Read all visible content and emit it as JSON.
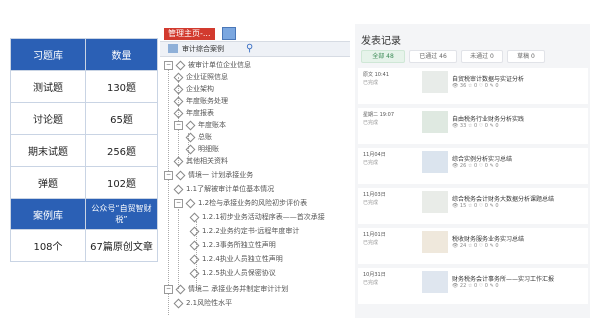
{
  "lib_table": {
    "header": [
      "习题库",
      "数量"
    ],
    "rows": [
      [
        "测试题",
        "130题"
      ],
      [
        "讨论题",
        "65题"
      ],
      [
        "期末试题",
        "256题"
      ],
      [
        "弹题",
        "102题"
      ]
    ],
    "header2": [
      "案例库",
      "公众号“自贸智财税”"
    ],
    "row2": [
      "108个",
      "67篇原创文章"
    ]
  },
  "tree": {
    "title": "管理主页-...",
    "toolbar_label": "审计综合案例",
    "nodes": [
      "被审计单位企业信息",
      "企业证照信息",
      "企业架构",
      "年度账务处理",
      "年度报表",
      "年度账本",
      "总账",
      "明细账",
      "其他相关资料",
      "情境一 计划承接业务",
      "1.1了解被审计单位基本情况",
      "1.2检与承接业务的风险初步评价表",
      "1.2.1初步业务活动程序表——首次承接",
      "1.2.2业务约定书-远程年度审计",
      "1.2.3事务所独立性声明",
      "1.2.4执业人员独立性声明",
      "1.2.5执业人员保密协议",
      "情境二 承接业务并制定审计计划",
      "2.1风险性水平"
    ]
  },
  "feed": {
    "title": "发表记录",
    "tabs": [
      "全部 48",
      "已通过 46",
      "未通过 0",
      "草稿 0"
    ],
    "posts": [
      {
        "meta": "原文 10:41",
        "meta2": "已完成",
        "title": "自贸税审计数据与实证分析",
        "stats": "👁 36   ☆ 0   ♡ 0   ✎ 0"
      },
      {
        "meta": "星期二 19:07",
        "meta2": "已完成",
        "title": "自由税务行业财务分析实践",
        "stats": "👁 33   ☆ 0   ♡ 0   ✎ 0"
      },
      {
        "meta": "11月04日",
        "meta2": "已完成",
        "title": "综合实例分析实习总结",
        "stats": "👁 26   ☆ 0   ♡ 0   ✎ 0"
      },
      {
        "meta": "11月03日",
        "meta2": "已完成",
        "title": "综合税务会计财务大数据分析课题总结",
        "stats": "👁 15   ☆ 0   ♡ 0   ✎ 0"
      },
      {
        "meta": "11月01日",
        "meta2": "已完成",
        "title": "税收财务服务业务实习总结",
        "stats": "👁 24   ☆ 0   ♡ 0   ✎ 0"
      },
      {
        "meta": "10月31日",
        "meta2": "已完成",
        "title": "财务税务会计事务所——实习工作汇报",
        "stats": "👁 22   ☆ 0   ♡ 0   ✎ 0"
      }
    ]
  },
  "colors": {
    "table_header": "#2b60b5",
    "title_red": "#d23a2e",
    "feed_bg": "#f4f5f7",
    "tab_active": "#3a8a55"
  },
  "icons": [
    "folder-icon",
    "search-icon",
    "expand-icon",
    "diamond-icon",
    "view-icon"
  ]
}
